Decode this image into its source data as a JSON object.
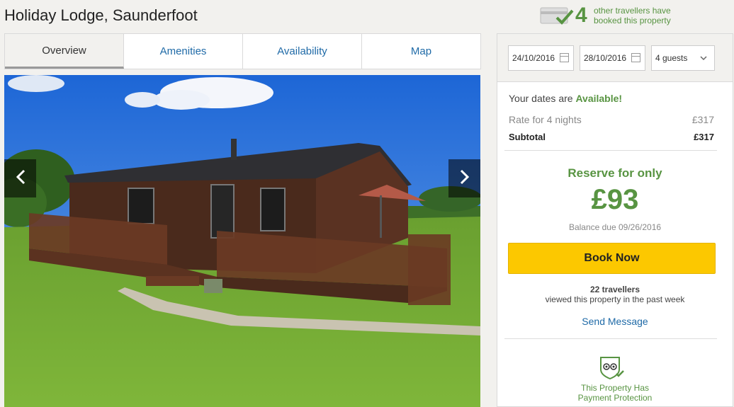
{
  "property": {
    "title": "Holiday Lodge, Saunderfoot"
  },
  "booked_banner": {
    "count": "4",
    "line1": "other travellers have",
    "line2": "booked this property"
  },
  "tabs": [
    {
      "label": "Overview",
      "active": true
    },
    {
      "label": "Amenities",
      "active": false
    },
    {
      "label": "Availability",
      "active": false
    },
    {
      "label": "Map",
      "active": false
    }
  ],
  "photo": {
    "prev_label": "‹",
    "next_label": "›"
  },
  "booking": {
    "checkin": "24/10/2016",
    "checkout": "28/10/2016",
    "guests": "4 guests",
    "availability_prefix": "Your dates are ",
    "availability_status": "Available!",
    "rate_label": "Rate for 4 nights",
    "rate_value": "£317",
    "subtotal_label": "Subtotal",
    "subtotal_value": "£317",
    "reserve_label": "Reserve for only",
    "reserve_amount": "£93",
    "balance_due": "Balance due 09/26/2016",
    "book_button": "Book Now",
    "viewed_count": "22 travellers",
    "viewed_text": "viewed this property in the past week",
    "send_message": "Send Message",
    "protection_line1": "This Property Has",
    "protection_line2": "Payment Protection"
  },
  "colors": {
    "accent_green": "#589442",
    "link_blue": "#1f6aa7",
    "button_yellow": "#fcc800"
  }
}
